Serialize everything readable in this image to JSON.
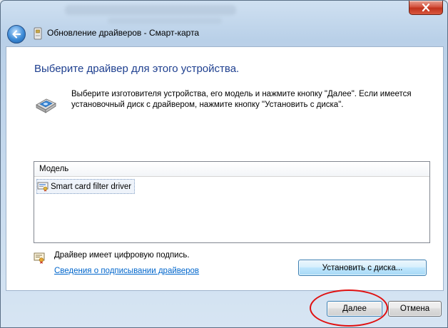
{
  "window": {
    "title": "Обновление драйверов - Смарт-карта",
    "close_icon": "close-x-icon",
    "back_icon": "back-arrow-icon"
  },
  "content": {
    "heading": "Выберите драйвер для этого устройства.",
    "instructions": "Выберите изготовителя устройства, его модель и нажмите кнопку \"Далее\". Если имеется установочный диск с  драйвером, нажмите кнопку \"Установить с диска\".",
    "list": {
      "header": "Модель",
      "items": [
        {
          "label": "Smart card filter driver",
          "icon": "driver-certificate-icon"
        }
      ]
    },
    "signature": {
      "text": "Драйвер имеет цифровую подпись.",
      "link": "Сведения о подписывании драйверов"
    },
    "install_from_disk": "Установить с диска..."
  },
  "footer": {
    "next_label": "Далее",
    "cancel_label": "Отмена"
  },
  "colors": {
    "heading": "#1e3f8f",
    "link": "#0066cc",
    "annotation": "#e01010"
  }
}
